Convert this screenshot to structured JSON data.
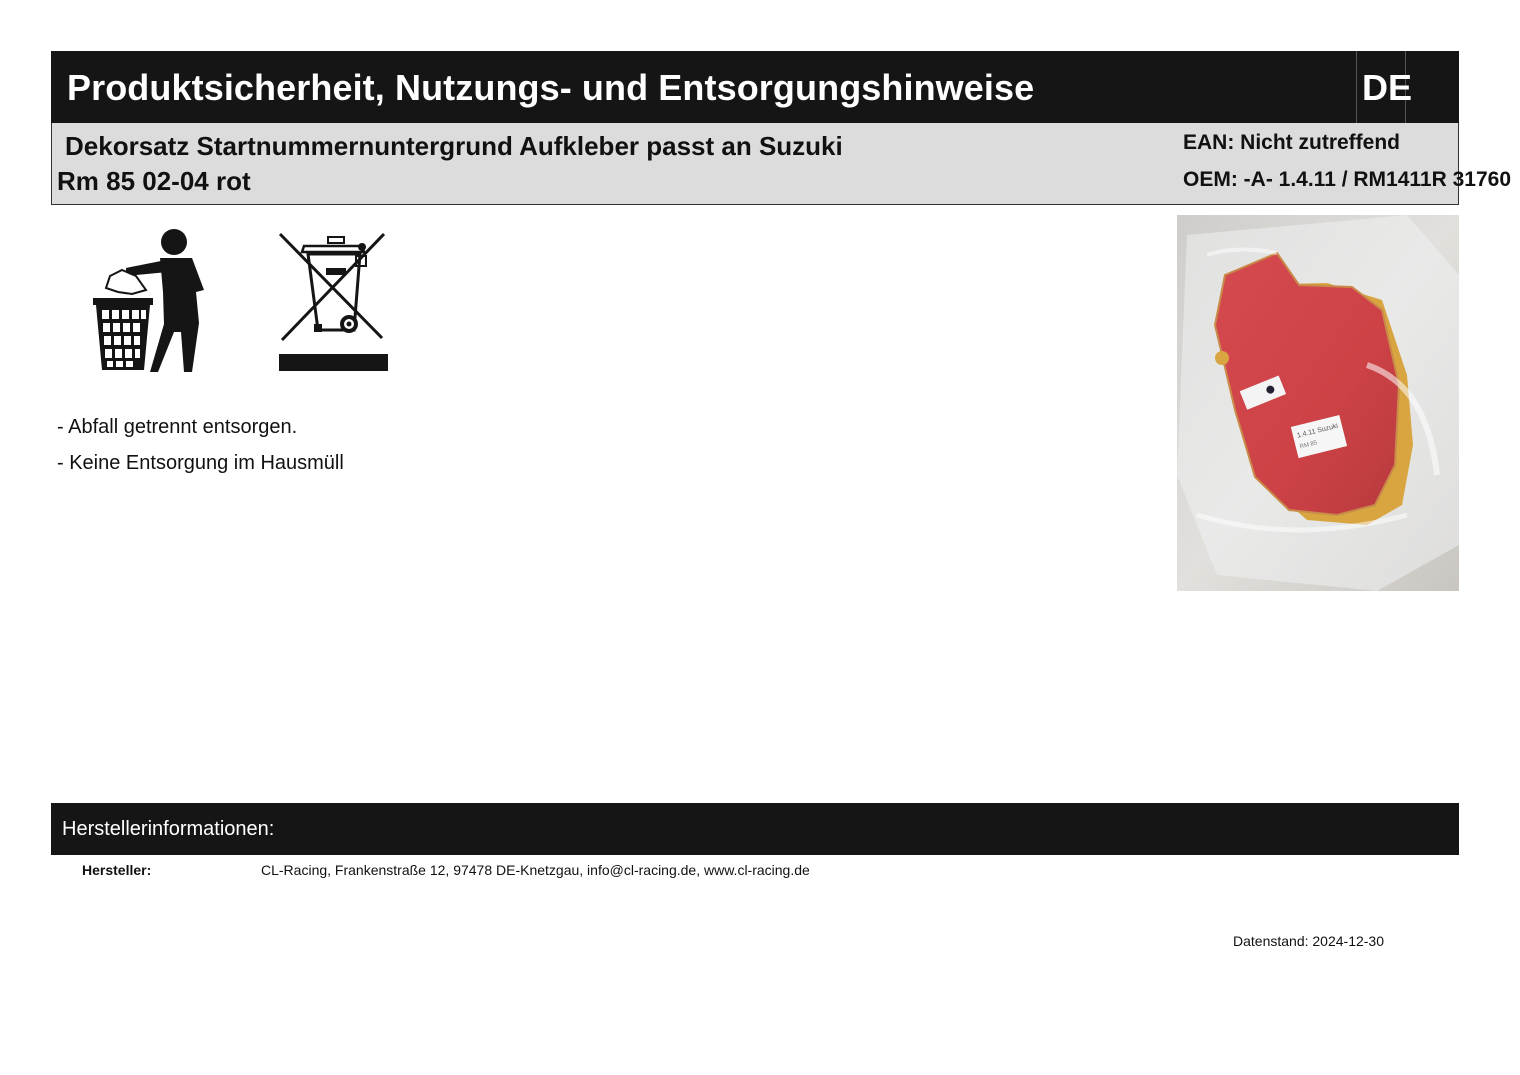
{
  "header": {
    "title": "Produktsicherheit, Nutzungs- und Entsorgungshinweise",
    "language": "DE"
  },
  "product": {
    "name_line1": "Dekorsatz Startnummernuntergrund Aufkleber passt an Suzuki",
    "name_line2": "Rm 85 02-04 rot",
    "ean": "EAN: Nicht zutreffend",
    "oem": "OEM: -A- 1.4.11 / RM1411R 31760"
  },
  "icons": {
    "litter": "dispose-in-bin-icon",
    "weee": "crossed-out-wheelie-bin-icon"
  },
  "disposal_notes": [
    "- Abfall getrennt entsorgen.",
    "- Keine Entsorgung im Hausmüll"
  ],
  "product_image": {
    "label_text_1": "1.4.11 Suzuki",
    "label_text_2": "RM 85",
    "colors": {
      "background": "#d9d7d3",
      "plate": "#cf4a4a",
      "backing": "#d8a540"
    }
  },
  "manufacturer": {
    "section_title": "Herstellerinformationen:",
    "label": "Hersteller:",
    "value": "CL-Racing, Frankenstraße 12, 97478 DE-Knetzgau, info@cl-racing.de, www.cl-racing.de"
  },
  "footer": {
    "data_date": "Datenstand: 2024-12-30"
  },
  "colors": {
    "header_bg": "#151515",
    "subheader_bg": "#dcdcdc",
    "header_text": "#ffffff"
  }
}
